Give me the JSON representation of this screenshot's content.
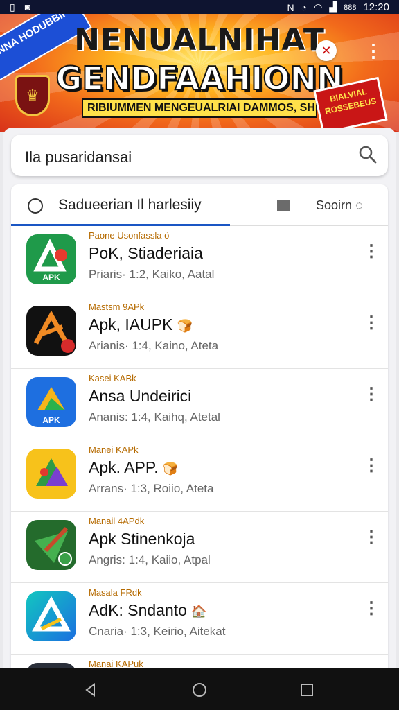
{
  "status_bar": {
    "time": "12:20",
    "battery_text": "888"
  },
  "banner": {
    "title_line1": "NENUALNIHAT",
    "title_line2": "GENDFAAHIONN",
    "subtitle": "RIBIUMMEN MENGEUALRIAI DAMMOS, SHIOOHAEH",
    "ribbon_text": "ANNA HODUBBII",
    "sale_badge_text": "BIALVIAL ROSSEBEUS",
    "close_label": "✕",
    "menu_label": "⋮"
  },
  "search": {
    "value": "Ila pusaridansai"
  },
  "tabs": {
    "active_label": "Sadueerian Il harlesiiy",
    "right_label": "Sooirn"
  },
  "apps": [
    {
      "publisher": "Paone Usonfassla ö",
      "name": "PoK, Stiaderiaia",
      "meta": "Priaris· 1:2, Kaiko, Aatal",
      "emoji": "",
      "icon": "apk-green-icon"
    },
    {
      "publisher": "Mastsm 9APk",
      "name": "Apk, IAUPK",
      "meta": "Arianis· 1:4, Kaino, Ateta",
      "emoji": "🍞",
      "icon": "apk-black-orange-icon"
    },
    {
      "publisher": "Kasei KABk",
      "name": "Ansa Undeirici",
      "meta": "Ananis: 1:4, Kaihq, Atetal",
      "emoji": "",
      "icon": "apk-blue-icon"
    },
    {
      "publisher": "Manei KAPk",
      "name": "Apk. APP.",
      "meta": "Arrans· 1:3, Roiio, Ateta",
      "emoji": "🍞",
      "icon": "apk-yellow-icon"
    },
    {
      "publisher": "Manail 4APdk",
      "name": "Apk Stinenkoja",
      "meta": "Angris: 1:4, Kaiio, Atpal",
      "emoji": "",
      "icon": "apk-dark-green-icon"
    },
    {
      "publisher": "Masala FRdk",
      "name": "AdK: Sndanto",
      "meta": "Cnaria· 1:3, Keirio, Aitekat",
      "emoji": "🏠",
      "icon": "apk-teal-icon"
    },
    {
      "publisher": "Manai KAPuk",
      "name": "",
      "meta": "",
      "emoji": "",
      "icon": "apk-dark-icon"
    }
  ],
  "colors": {
    "accent": "#1a56c4",
    "publisher_text": "#b56a00"
  }
}
